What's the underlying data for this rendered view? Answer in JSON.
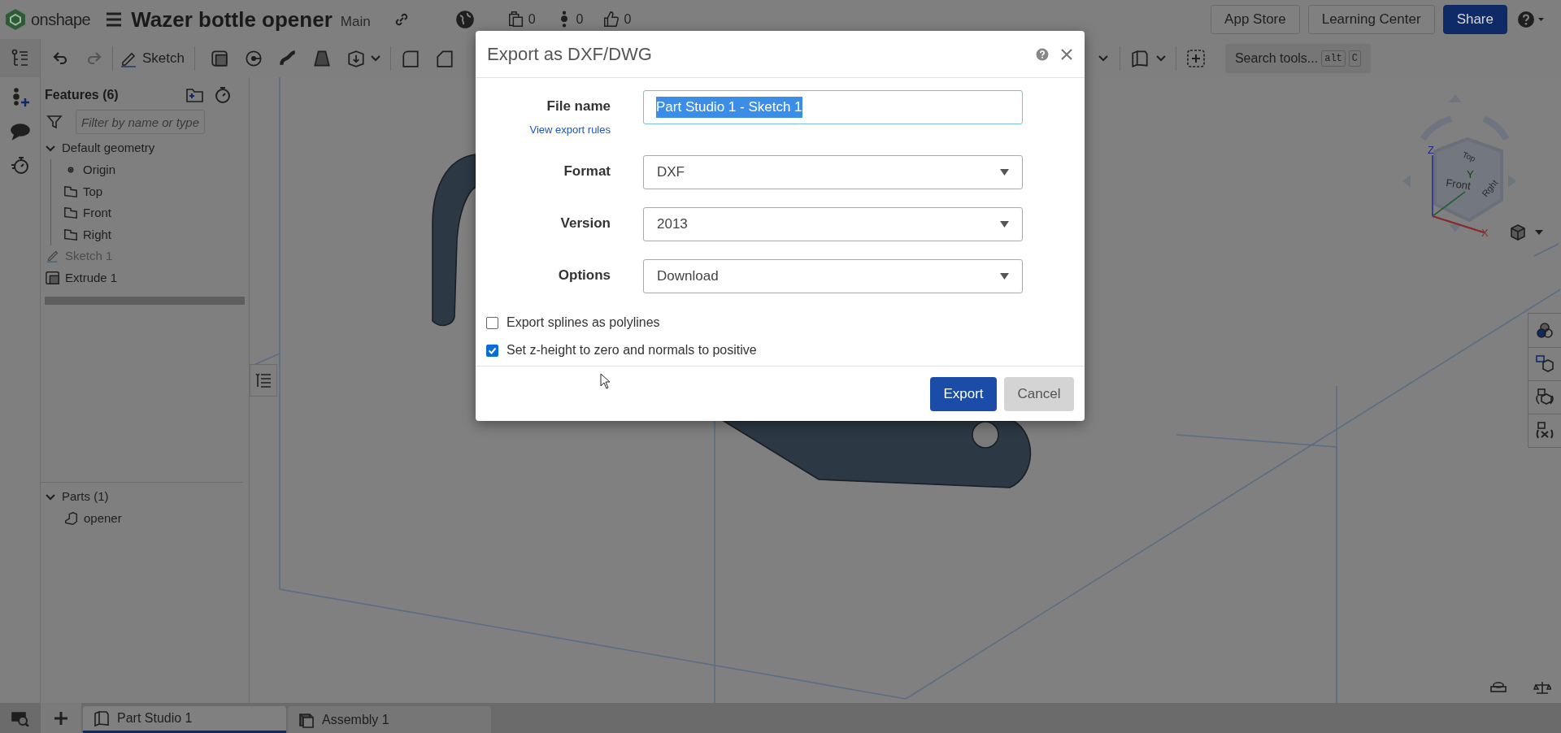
{
  "header": {
    "logo": "onshape",
    "title": "Wazer bottle opener",
    "branch": "Main",
    "counters": [
      {
        "kind": "versions",
        "value": "0"
      },
      {
        "kind": "followers",
        "value": "0"
      },
      {
        "kind": "likes",
        "value": "0"
      }
    ],
    "buttons": [
      {
        "label": "App Store",
        "kind": "plain"
      },
      {
        "label": "Learning Center",
        "kind": "plain"
      },
      {
        "label": "Share",
        "kind": "primary"
      }
    ]
  },
  "toolbar": {
    "sketch": "Sketch",
    "search": {
      "placeholder": "Search tools...",
      "keys": [
        "alt",
        "C"
      ]
    }
  },
  "features": {
    "title": "Features (6)",
    "filter": {
      "placeholder": "Filter by name or type"
    },
    "tree": [
      {
        "label": "Default geometry",
        "kind": "group",
        "expanded": true,
        "children": [
          {
            "label": "Origin",
            "kind": "point",
            "hidden": false
          },
          {
            "label": "Top",
            "kind": "plane",
            "hidden": false
          },
          {
            "label": "Front",
            "kind": "plane",
            "hidden": false
          },
          {
            "label": "Right",
            "kind": "plane",
            "hidden": false
          }
        ]
      },
      {
        "label": "Sketch 1",
        "kind": "sketch",
        "hidden": true
      },
      {
        "label": "Extrude 1",
        "kind": "extrude",
        "hidden": false
      }
    ]
  },
  "parts": {
    "title": "Parts (1)",
    "expanded": true,
    "items": [
      {
        "label": "opener"
      }
    ]
  },
  "view_cube": {
    "faces": [
      "Top",
      "Front",
      "Rght"
    ],
    "axes": [
      "X",
      "Y",
      "Z"
    ]
  },
  "tabs": [
    {
      "label": "Part Studio 1",
      "kind": "partstudio",
      "selected": true
    },
    {
      "label": "Assembly 1",
      "kind": "assembly",
      "selected": false
    }
  ],
  "dialog": {
    "title": "Export as DXF/DWG",
    "fields": [
      {
        "label": "File name",
        "link": "View export rules",
        "kind": "text",
        "value": "Part Studio 1 - Sketch 1",
        "text_selected": true
      },
      {
        "label": "Format",
        "kind": "select",
        "value": "DXF"
      },
      {
        "label": "Version",
        "kind": "select",
        "value": "2013"
      },
      {
        "label": "Options",
        "kind": "select",
        "value": "Download"
      }
    ],
    "checkboxes": [
      {
        "label": "Export splines as polylines",
        "checked": false
      },
      {
        "label": "Set z-height to zero and normals to positive",
        "checked": true
      }
    ],
    "buttons": [
      {
        "label": "Export",
        "kind": "primary"
      },
      {
        "label": "Cancel",
        "kind": "secondary"
      }
    ]
  }
}
